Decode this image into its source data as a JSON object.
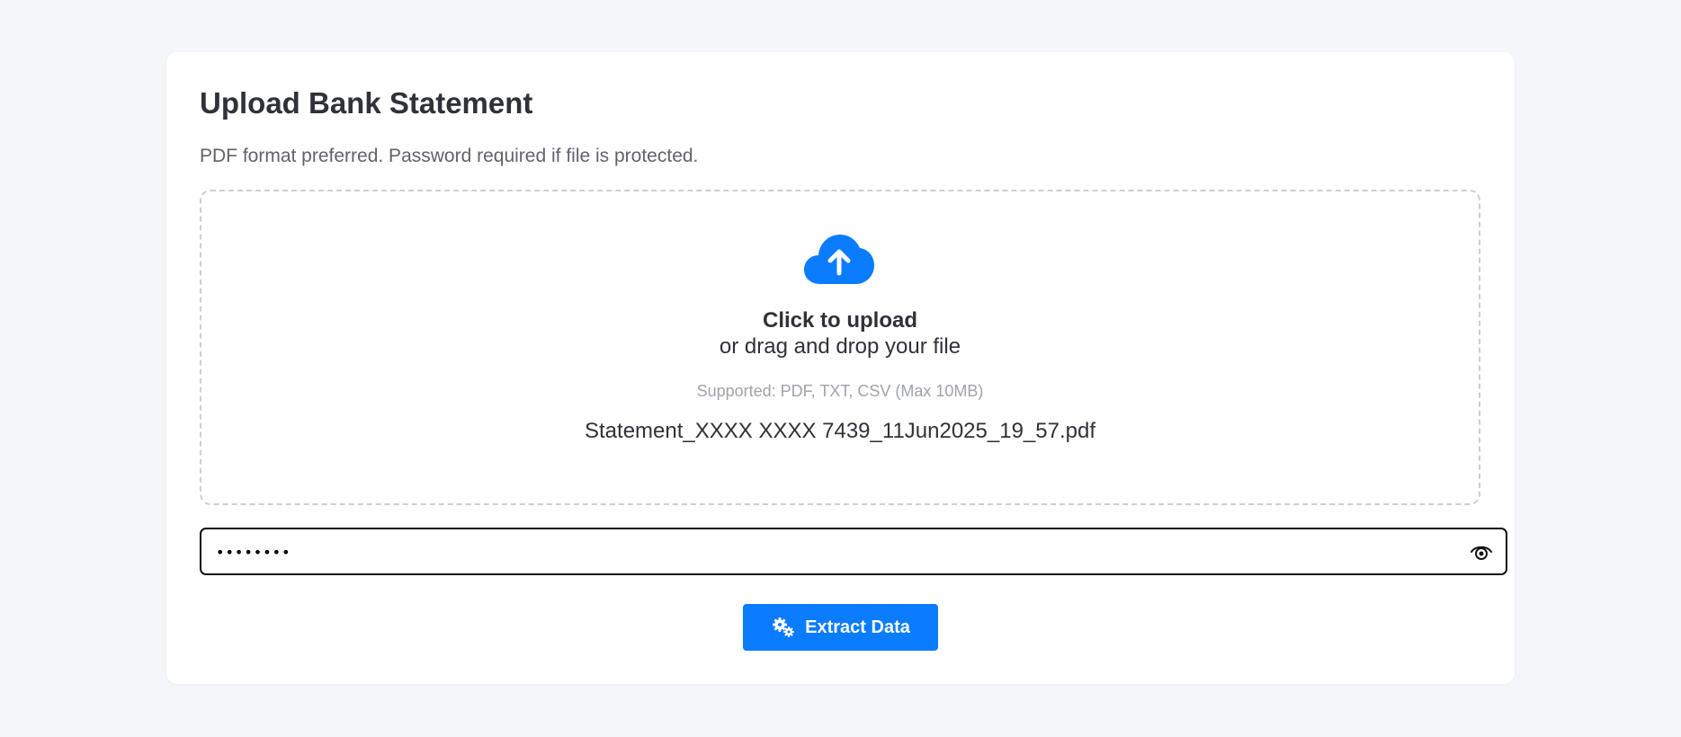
{
  "card": {
    "title": "Upload Bank Statement",
    "subtitle": "PDF format preferred. Password required if file is protected."
  },
  "dropzone": {
    "icon": "cloud-upload-icon",
    "click_label": "Click to upload",
    "drag_label": "or drag and drop your file",
    "supported": "Supported: PDF, TXT, CSV (Max 10MB)",
    "selected_file": "Statement_XXXX XXXX 7439_11Jun2025_19_57.pdf"
  },
  "password": {
    "value": "••••••••",
    "toggle_icon": "eye-icon"
  },
  "actions": {
    "extract_label": "Extract Data",
    "extract_icon": "gears-icon"
  },
  "colors": {
    "accent": "#0a7cff",
    "background": "#f5f6f9",
    "card": "#ffffff"
  }
}
